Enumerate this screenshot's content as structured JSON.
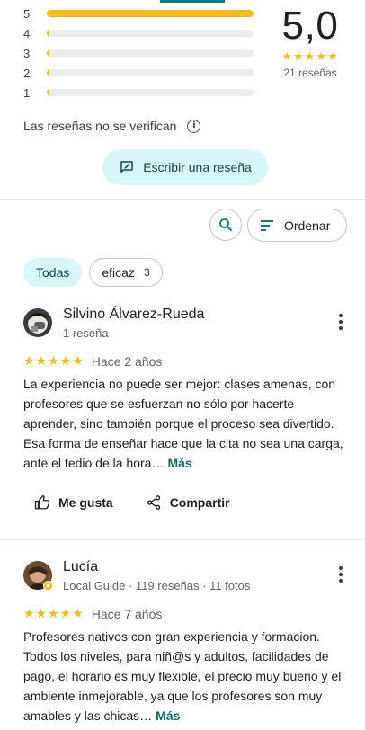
{
  "histogram": [
    {
      "stars": "5",
      "fraction": 1.0
    },
    {
      "stars": "4",
      "fraction": 0.0
    },
    {
      "stars": "3",
      "fraction": 0.0
    },
    {
      "stars": "2",
      "fraction": 0.0
    },
    {
      "stars": "1",
      "fraction": 0.0
    }
  ],
  "summary": {
    "score": "5,0",
    "stars": "★★★★★",
    "count": "21 reseñas"
  },
  "notice": "Las reseñas no se verifican",
  "write_review": "Escribir una reseña",
  "sort_label": "Ordenar",
  "chips": [
    {
      "label": "Todas"
    },
    {
      "label": "eficaz",
      "count": "3"
    }
  ],
  "reviews": [
    {
      "name": "Silvino Álvarez-Rueda",
      "subtitle": "1 reseña",
      "stars": "★★★★★",
      "time": "Hace 2 años",
      "text": "La experiencia no puede ser mejor: clases amenas, con profesores que se esfuerzan no sólo por hacerte aprender, sino también porque el proceso sea divertido. Esa forma de enseñar hace que la cita no sea una carga, ante el tedio de la hora…",
      "more": "Más",
      "like": "Me gusta",
      "share": "Compartir"
    },
    {
      "name": "Lucía",
      "subtitle": "Local Guide · 119 reseñas · 11 fotos",
      "stars": "★★★★★",
      "time": "Hace 7 años",
      "text": "Profesores nativos con gran experiencia y formacion. Todos los niveles, para niñ@s y adultos, facilidades de pago, el horario es muy flexible, el precio muy bueno y el ambiente inmejorable, ya que los profesores son muy amables y las chicas…",
      "more": "Más"
    }
  ],
  "colors": {
    "star": "#f5bb1a",
    "accent": "#0b7c79",
    "chip_bg": "#d7f6f7"
  }
}
